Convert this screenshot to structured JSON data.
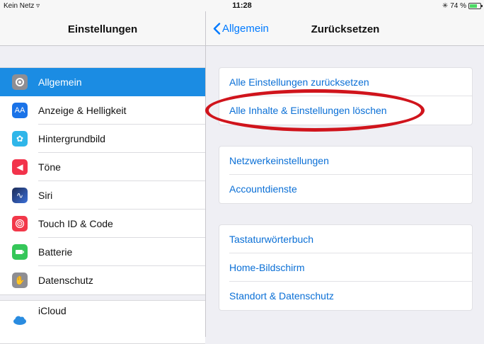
{
  "status": {
    "carrier": "Kein Netz",
    "time": "11:28",
    "battery": "74 %",
    "battery_level": 0.74
  },
  "sidebar": {
    "title": "Einstellungen",
    "items": [
      {
        "label": "Allgemein",
        "icon": "gear-icon",
        "color": "#8e8e93",
        "selected": true
      },
      {
        "label": "Anzeige & Helligkeit",
        "icon": "text-size-icon",
        "color": "#1a73e8"
      },
      {
        "label": "Hintergrundbild",
        "icon": "wallpaper-icon",
        "color": "#2fb6e9"
      },
      {
        "label": "Töne",
        "icon": "speaker-icon",
        "color": "#f2334b"
      },
      {
        "label": "Siri",
        "icon": "siri-icon",
        "color": "#2a3a66"
      },
      {
        "label": "Touch ID & Code",
        "icon": "fingerprint-icon",
        "color": "#f2384a"
      },
      {
        "label": "Batterie",
        "icon": "battery-icon",
        "color": "#35c759"
      },
      {
        "label": "Datenschutz",
        "icon": "hand-icon",
        "color": "#8e8e93"
      }
    ],
    "icloud": {
      "label": "iCloud",
      "icon": "cloud-icon"
    }
  },
  "detail": {
    "back_label": "Allgemein",
    "title": "Zurücksetzen",
    "groups": [
      [
        "Alle Einstellungen zurücksetzen",
        "Alle Inhalte & Einstellungen löschen"
      ],
      [
        "Netzwerkeinstellungen",
        "Accountdienste"
      ],
      [
        "Tastaturwörterbuch",
        "Home-Bildschirm",
        "Standort & Datenschutz"
      ]
    ]
  },
  "colors": {
    "accent": "#007aff",
    "selection": "#1b8ce3",
    "annotation": "#d0141c"
  }
}
